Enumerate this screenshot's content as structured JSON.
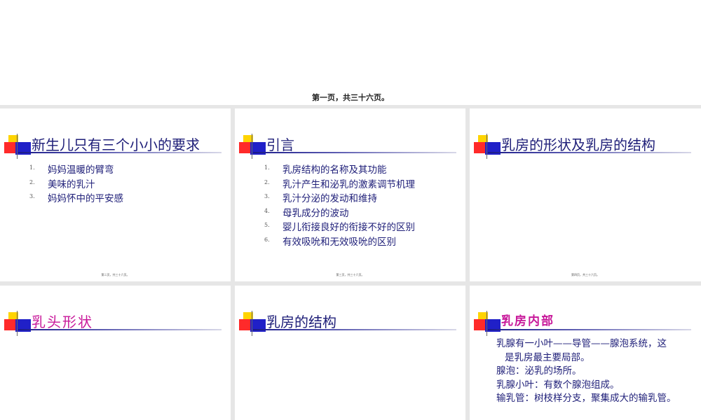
{
  "top_caption": "第一页，共三十六页。",
  "slides": [
    {
      "title": "新生儿只有三个小小的要求",
      "items": [
        {
          "num": "1.",
          "text": "妈妈温暖的臂弯"
        },
        {
          "num": "2.",
          "text": "美味的乳汁"
        },
        {
          "num": "3.",
          "text": "妈妈怀中的平安感"
        }
      ],
      "footer": "第二页，共三十六页。"
    },
    {
      "title": "引言",
      "items": [
        {
          "num": "1.",
          "text": "乳房结构的名称及其功能"
        },
        {
          "num": "2.",
          "text": "乳汁产生和泌乳的激素调节机理"
        },
        {
          "num": "3.",
          "text": "乳汁分泌的发动和维持"
        },
        {
          "num": "4.",
          "text": "母乳成分的波动"
        },
        {
          "num": "5.",
          "text": "婴儿衔接良好的衔接不好的区别"
        },
        {
          "num": "6.",
          "text": "有效吸吮和无效吸吮的区别"
        }
      ],
      "footer": "第三页，共三十六页。"
    },
    {
      "title": "乳房的形状及乳房的结构",
      "footer": "第四页，共三十六页。"
    },
    {
      "title": "乳头形状"
    },
    {
      "title": "乳房的结构"
    },
    {
      "title": "乳房内部",
      "paragraphs": [
        "乳腺有一小叶——导管——腺泡系统，这",
        "是乳房最主要局部。",
        "腺泡：泌乳的场所。",
        "乳腺小叶：有数个腺泡组成。",
        "输乳管：树枝样分支，聚集成大的输乳管。"
      ]
    }
  ]
}
